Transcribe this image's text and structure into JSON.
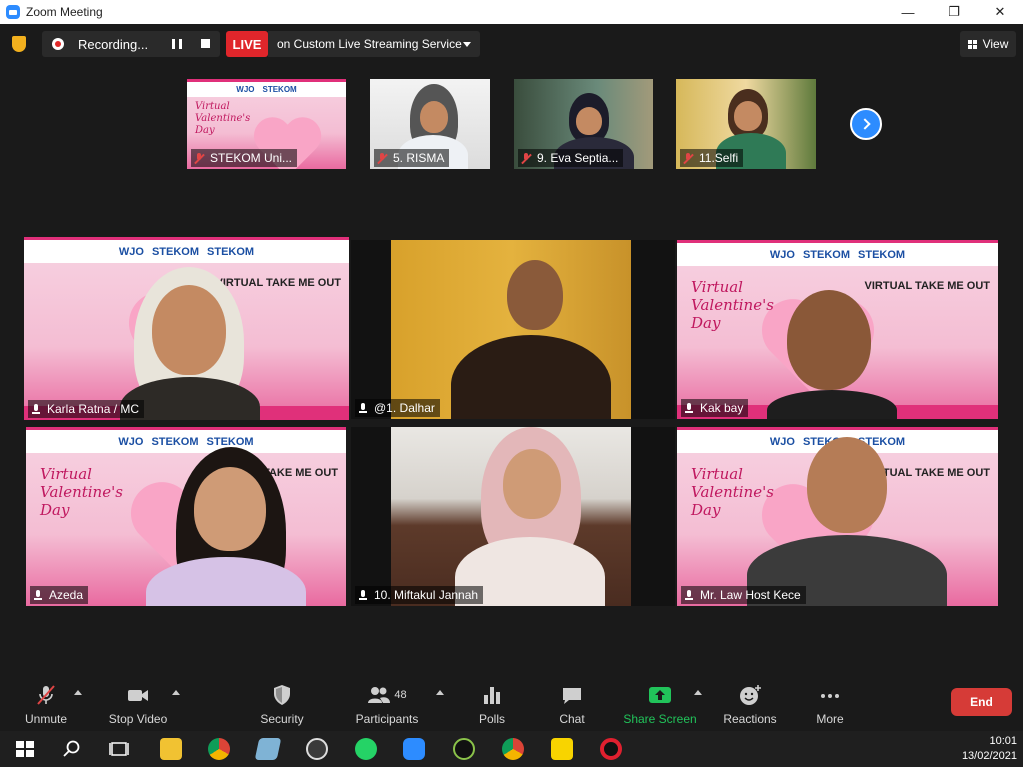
{
  "window": {
    "title": "Zoom Meeting",
    "minimize": "—",
    "maximize": "❐",
    "close": "✕"
  },
  "topbar": {
    "recording_label": "Recording...",
    "live_label": "LIVE",
    "live_service": "on Custom Live Streaming Service",
    "view_label": "View"
  },
  "strip": [
    {
      "name": "STEKOM Uni...",
      "muted": true
    },
    {
      "name": "5. RISMA",
      "muted": true
    },
    {
      "name": "9. Eva Septia...",
      "muted": true
    },
    {
      "name": "11.Selfi",
      "muted": true
    }
  ],
  "gallery": [
    {
      "name": "Karla Ratna / MC",
      "muted": false,
      "active": true
    },
    {
      "name": "@1. Dalhar",
      "muted": false
    },
    {
      "name": "Kak bay",
      "muted": false
    },
    {
      "name": "Azeda",
      "muted": false
    },
    {
      "name": "10. Miftakul Jannah",
      "muted": false
    },
    {
      "name": "Mr. Law Host Kece",
      "muted": false
    }
  ],
  "banner": {
    "logo1": "WJO",
    "logo2": "STEKOM",
    "logo3": "STEKOM",
    "script": "Virtual Valentine's Day",
    "tagline": "VIRTUAL TAKE ME OUT"
  },
  "toolbar": {
    "unmute": "Unmute",
    "stop_video": "Stop Video",
    "security": "Security",
    "participants": "Participants",
    "participants_count": "48",
    "polls": "Polls",
    "chat": "Chat",
    "share_screen": "Share Screen",
    "reactions": "Reactions",
    "more": "More",
    "end": "End"
  },
  "taskbar": {
    "time": "10:01",
    "date": "13/02/2021"
  },
  "colors": {
    "accent": "#2d8cff",
    "live": "#e0262b",
    "end": "#d63b37",
    "share": "#21c35a",
    "active_speaker": "#d9e85a"
  }
}
